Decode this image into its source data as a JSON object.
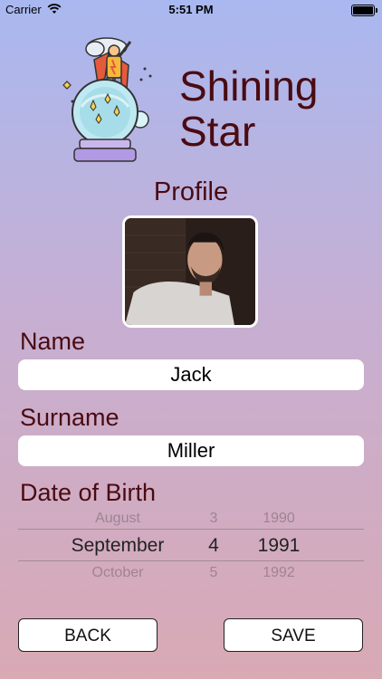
{
  "status_bar": {
    "carrier": "Carrier",
    "time": "5:51 PM"
  },
  "header": {
    "title_line1": "Shining",
    "title_line2": "Star",
    "section_title": "Profile"
  },
  "form": {
    "name": {
      "label": "Name",
      "value": "Jack"
    },
    "surname": {
      "label": "Surname",
      "value": "Miller"
    },
    "dob": {
      "label": "Date of Birth",
      "picker": {
        "above": {
          "month": "August",
          "day": "3",
          "year": "1990"
        },
        "selected": {
          "month": "September",
          "day": "4",
          "year": "1991"
        },
        "below": {
          "month": "October",
          "day": "5",
          "year": "1992"
        }
      }
    }
  },
  "actions": {
    "back_label": "BACK",
    "save_label": "SAVE"
  },
  "icons": [
    "wifi-icon",
    "battery-icon",
    "crystal-ball-logo-icon",
    "profile-avatar"
  ]
}
